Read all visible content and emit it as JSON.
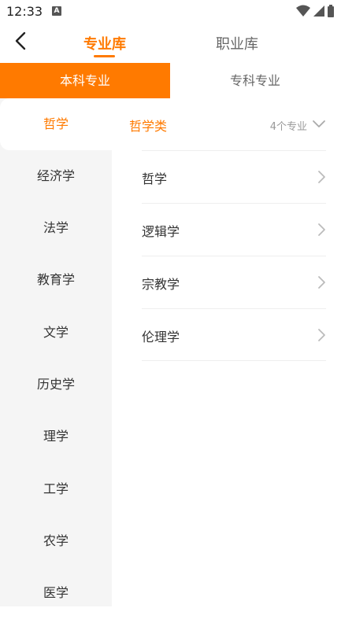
{
  "status": {
    "time": "12:33",
    "badge": "A"
  },
  "nav": {
    "tabs": [
      {
        "label": "专业库",
        "active": true
      },
      {
        "label": "职业库",
        "active": false
      }
    ]
  },
  "level_tabs": [
    {
      "label": "本科专业",
      "active": true
    },
    {
      "label": "专科专业",
      "active": false
    }
  ],
  "sidebar": {
    "items": [
      {
        "label": "哲学",
        "active": true
      },
      {
        "label": "经济学"
      },
      {
        "label": "法学"
      },
      {
        "label": "教育学"
      },
      {
        "label": "文学"
      },
      {
        "label": "历史学"
      },
      {
        "label": "理学"
      },
      {
        "label": "工学"
      },
      {
        "label": "农学"
      },
      {
        "label": "医学"
      }
    ]
  },
  "category": {
    "title": "哲学类",
    "count": "4个专业"
  },
  "majors": [
    {
      "label": "哲学"
    },
    {
      "label": "逻辑学"
    },
    {
      "label": "宗教学"
    },
    {
      "label": "伦理学"
    }
  ],
  "colors": {
    "accent": "#ff7a00",
    "sidebar_bg": "#f5f5f5",
    "divider": "#eeeeee"
  }
}
